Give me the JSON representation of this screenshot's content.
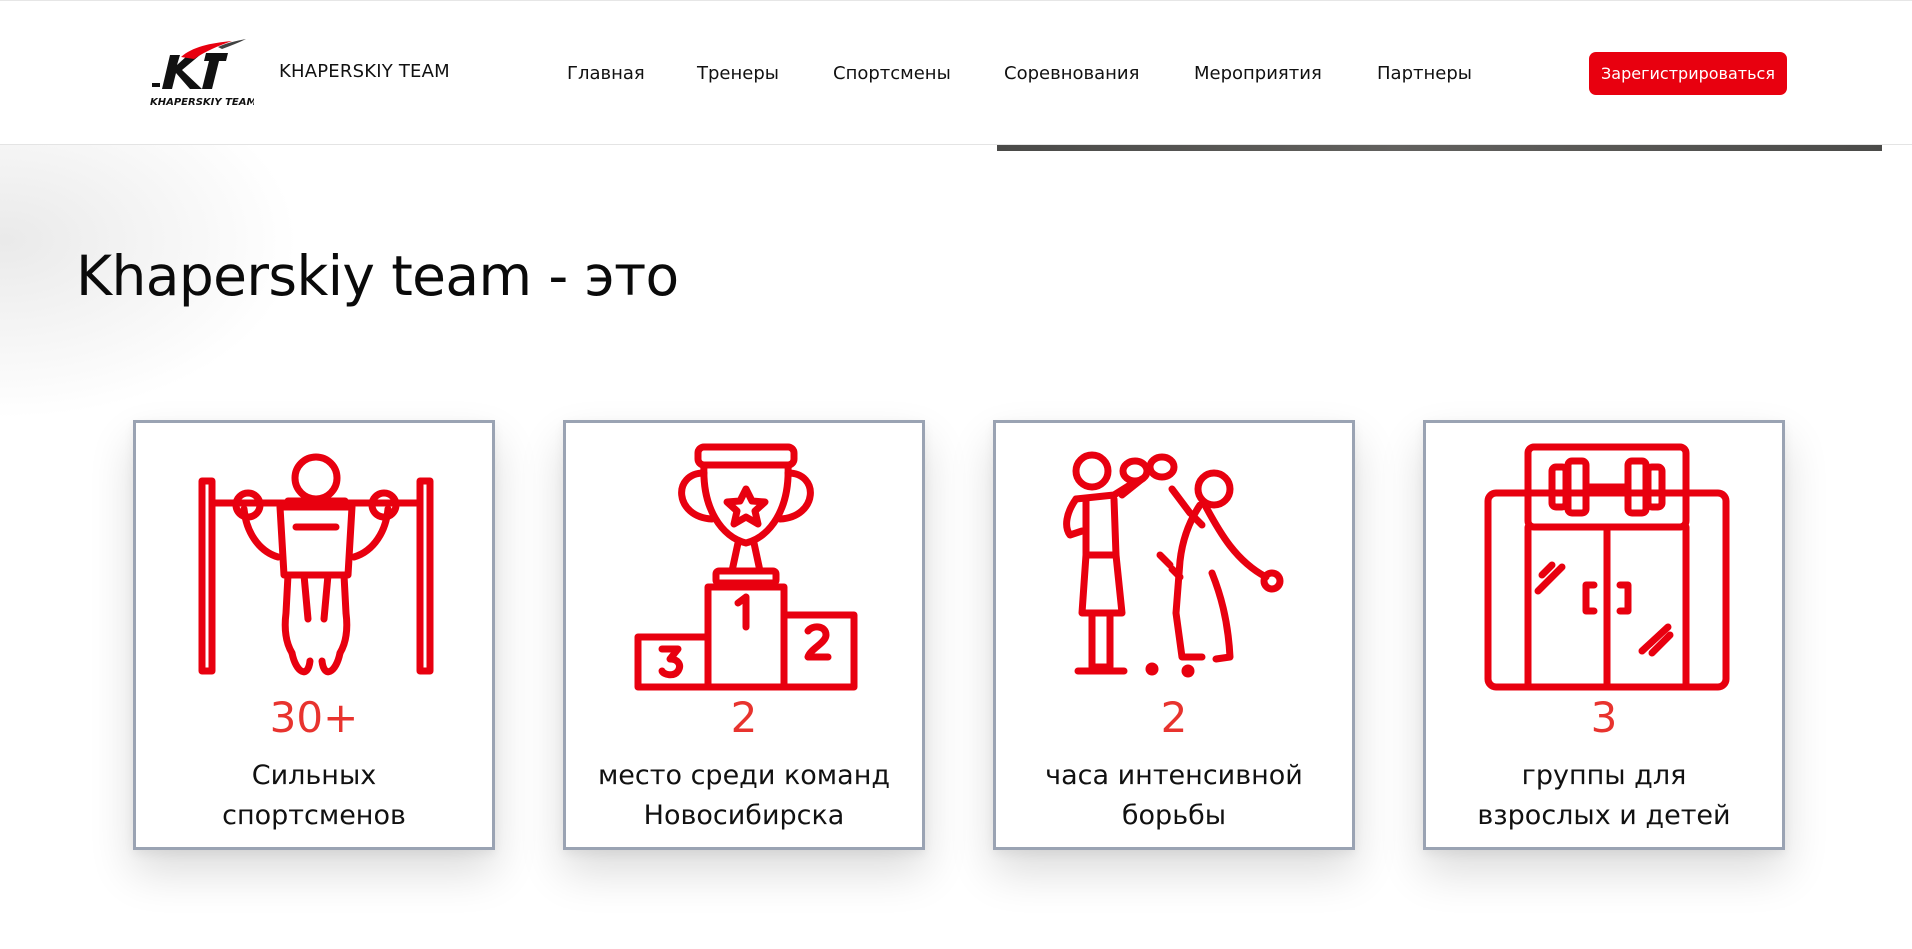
{
  "header": {
    "logo_text": "KHAPERSKIY TEAM",
    "brand": "KHAPERSKIY TEAM",
    "nav": [
      {
        "label": "Главная"
      },
      {
        "label": "Тренеры"
      },
      {
        "label": "Спортсмены"
      },
      {
        "label": "Соревнования"
      },
      {
        "label": "Мероприятия"
      },
      {
        "label": "Партнеры"
      }
    ],
    "register_label": "Зарегистрироваться"
  },
  "section": {
    "title": "Khaperskiy team - это"
  },
  "stats": [
    {
      "icon": "pull-up-icon",
      "value": "30+",
      "line1": "Сильных",
      "line2": "спортсменов"
    },
    {
      "icon": "trophy-podium-icon",
      "value": "2",
      "line1": "место среди команд",
      "line2": "Новосибирска"
    },
    {
      "icon": "martial-arts-icon",
      "value": "2",
      "line1": "часа интенсивной",
      "line2": "борьбы"
    },
    {
      "icon": "gym-icon",
      "value": "3",
      "line1": "группы для",
      "line2": "взрослых и детей"
    }
  ],
  "colors": {
    "accent": "#e8000f",
    "icon": "#e8000f",
    "stat_value": "#e8332e",
    "card_border": "#9aa3b3"
  }
}
